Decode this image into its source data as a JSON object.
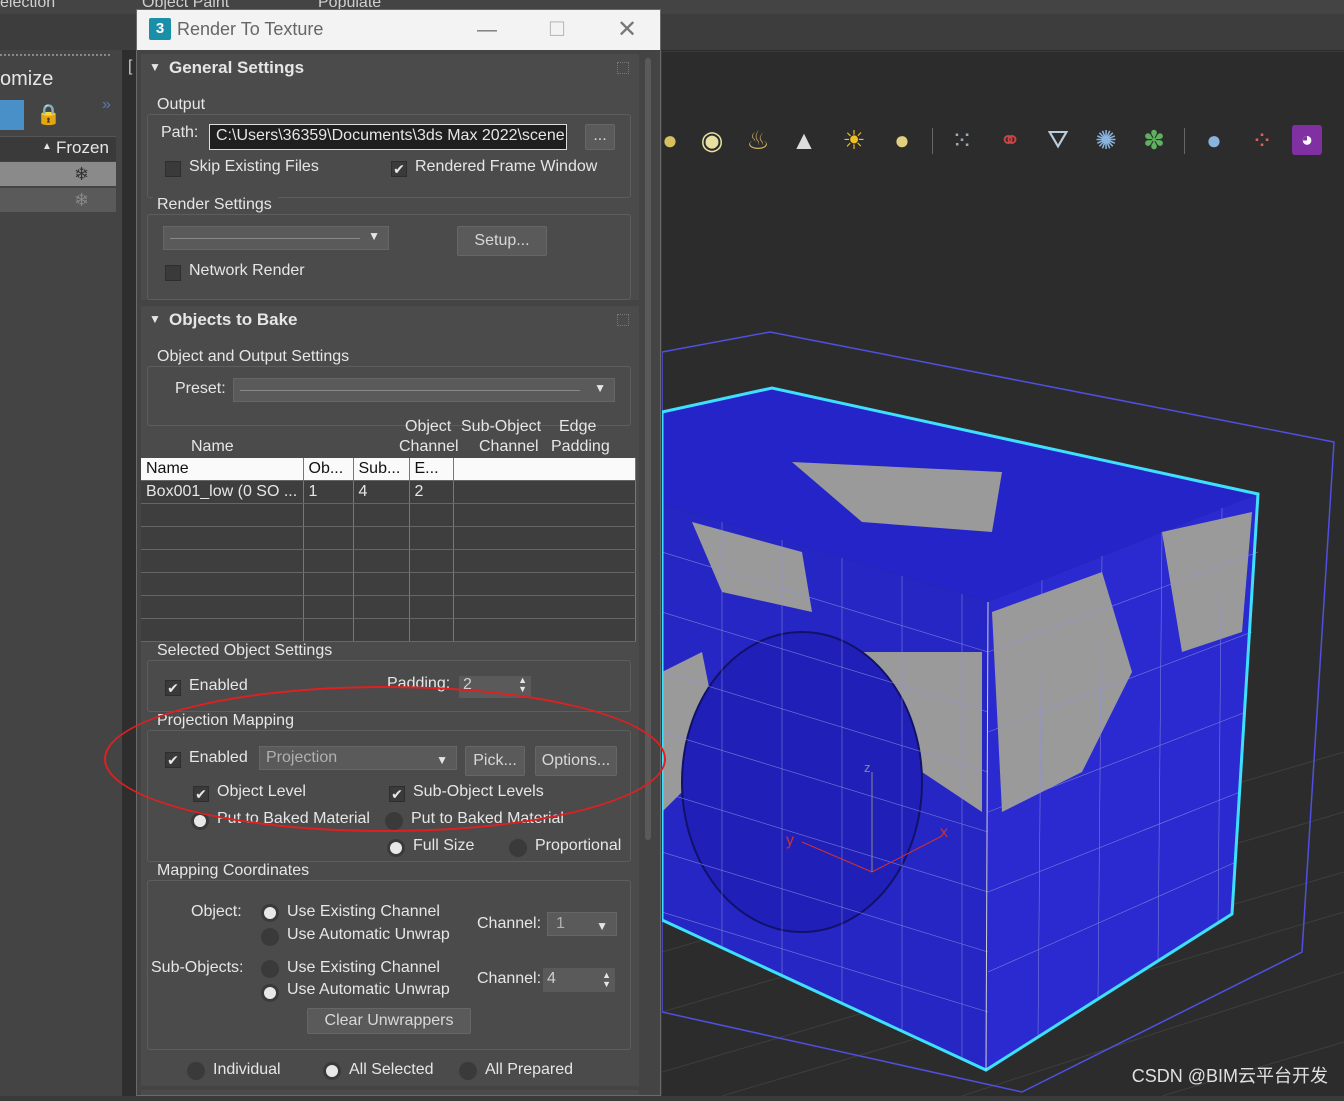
{
  "app": {
    "top_menu": [
      "election",
      "Object Paint",
      "Populate"
    ],
    "explorer_title": "omize",
    "explorer_column": "Frozen"
  },
  "dialog": {
    "title": "Render To Texture",
    "general": {
      "header": "General Settings",
      "output_label": "Output",
      "path_label": "Path:",
      "path_value": "C:\\Users\\36359\\Documents\\3ds Max 2022\\scene",
      "browse_label": "...",
      "skip_existing": "Skip Existing Files",
      "rendered_frame": "Rendered Frame Window",
      "render_settings_label": "Render Settings",
      "setup_label": "Setup...",
      "network_render": "Network Render"
    },
    "objects": {
      "header": "Objects to Bake",
      "oos_label": "Object and Output Settings",
      "preset_label": "Preset:",
      "col_name": "Name",
      "col_object_channel_1": "Object",
      "col_object_channel_2": "Channel",
      "col_sub_object_1": "Sub-Object",
      "col_sub_object_2": "Channel",
      "col_edge_1": "Edge",
      "col_edge_2": "Padding",
      "table_headers": [
        "Name",
        "Ob...",
        "Sub...",
        "E...",
        ""
      ],
      "rows": [
        [
          "Box001_low (0 SO ...",
          "1",
          "4",
          "2",
          ""
        ]
      ],
      "selected_settings_label": "Selected Object Settings",
      "enabled_label": "Enabled",
      "padding_label": "Padding:",
      "padding_value": "2",
      "projection_label": "Projection Mapping",
      "proj_enabled": "Enabled",
      "proj_dropdown": "Projection",
      "pick_label": "Pick...",
      "options_label": "Options...",
      "object_level": "Object Level",
      "sub_object_levels": "Sub-Object Levels",
      "put_baked_1": "Put to Baked Material",
      "put_baked_2": "Put to Baked Material",
      "full_size": "Full Size",
      "proportional": "Proportional",
      "mapping_label": "Mapping Coordinates",
      "object_label": "Object:",
      "use_existing_1": "Use Existing Channel",
      "use_auto_1": "Use Automatic Unwrap",
      "channel_label_1": "Channel:",
      "channel_value_1": "1",
      "sub_objects_label": "Sub-Objects:",
      "use_existing_2": "Use Existing Channel",
      "use_auto_2": "Use Automatic Unwrap",
      "channel_label_2": "Channel:",
      "channel_value_2": "4",
      "clear_unwrappers": "Clear Unwrappers",
      "individual": "Individual",
      "all_selected": "All Selected",
      "all_prepared": "All Prepared"
    }
  },
  "viewport": {
    "axis_y": "y",
    "axis_x": "x",
    "axis_z": "z"
  },
  "watermark": "CSDN @BIM云平台开发",
  "colors": {
    "mesh_blue": "#2424c8",
    "selection_cyan": "#3fe0ff",
    "annotation_red": "#e02020"
  }
}
